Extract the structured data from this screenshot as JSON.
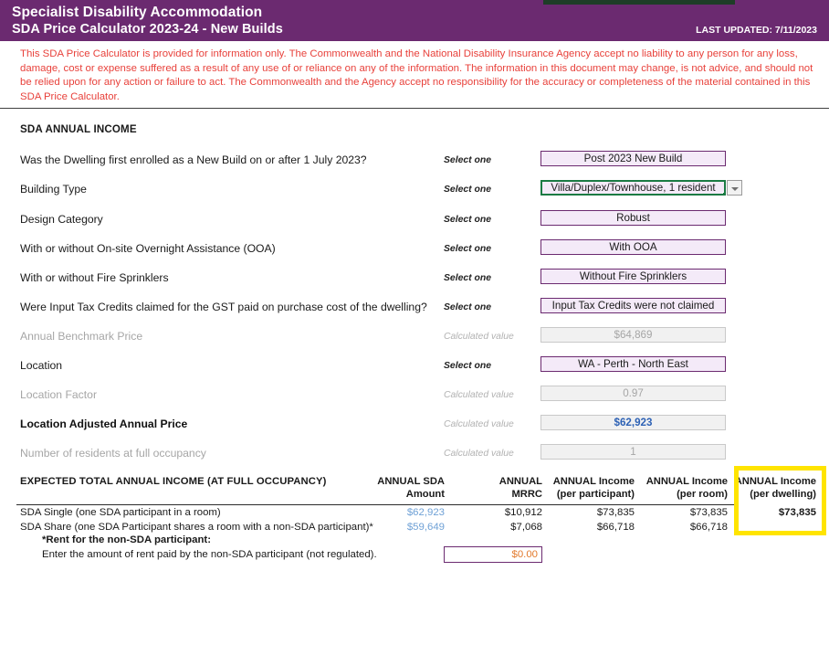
{
  "header": {
    "title": "Specialist Disability Accommodation",
    "subtitle": "SDA Price Calculator 2023-24 - New Builds",
    "last_updated": "LAST UPDATED: 7/11/2023",
    "bg_color": "#6B2A70"
  },
  "disclaimer": {
    "text": "This SDA Price Calculator is provided for information only.  The Commonwealth and the National Disability Insurance Agency accept no liability to any person for any loss, damage, cost or expense suffered as a result of any use of or reliance on any of the information.  The information in this document may change, is not advice, and should not be relied upon for any action or failure to act. The Commonwealth and the Agency accept no responsibility for the accuracy or completeness of the material contained in this SDA Price Calculator.",
    "color": "#E8413B"
  },
  "section": {
    "heading": "SDA ANNUAL INCOME"
  },
  "hints": {
    "select_one": "Select one",
    "calculated_value": "Calculated value"
  },
  "form": {
    "rows": [
      {
        "label": "Was the Dwelling first enrolled as a New Build on or after 1 July 2023?",
        "hint": "Select one",
        "value": "Post 2023 New Build",
        "kind": "select"
      },
      {
        "label": "Building Type",
        "hint": "Select one",
        "value": "Villa/Duplex/Townhouse, 1 resident",
        "kind": "select-active"
      },
      {
        "label": "Design Category",
        "hint": "Select one",
        "value": "Robust",
        "kind": "select"
      },
      {
        "label": "With or without On-site Overnight Assistance (OOA)",
        "hint": "Select one",
        "value": "With OOA",
        "kind": "select"
      },
      {
        "label": "With or without Fire Sprinklers",
        "hint": "Select one",
        "value": "Without Fire Sprinklers",
        "kind": "select"
      },
      {
        "label": "Were Input Tax Credits claimed for the GST paid on purchase cost of the dwelling?",
        "hint": "Select one",
        "value": "Input Tax Credits were not claimed",
        "kind": "select"
      },
      {
        "label": "Annual Benchmark Price",
        "hint": "Calculated value",
        "value": "$64,869",
        "kind": "calc"
      },
      {
        "label": "Location",
        "hint": "Select one",
        "value": "WA - Perth - North East",
        "kind": "select"
      },
      {
        "label": "Location Factor",
        "hint": "Calculated value",
        "value": "0.97",
        "kind": "calc"
      },
      {
        "label": "Location Adjusted Annual Price",
        "hint": "Calculated value",
        "value": "$62,923",
        "kind": "calc-strong"
      },
      {
        "label": "Number of residents at full occupancy",
        "hint": "Calculated value",
        "value": "1",
        "kind": "calc"
      }
    ]
  },
  "results": {
    "title": "EXPECTED TOTAL ANNUAL INCOME (AT FULL OCCUPANCY)",
    "columns": [
      {
        "line1": "ANNUAL SDA",
        "line2": "Amount"
      },
      {
        "line1": "ANNUAL",
        "line2": "MRRC"
      },
      {
        "line1": "ANNUAL Income",
        "line2": "(per participant)"
      },
      {
        "line1": "ANNUAL Income",
        "line2": "(per room)"
      },
      {
        "line1": "ANNUAL Income",
        "line2": "(per dwelling)"
      }
    ],
    "rows": [
      {
        "label": "SDA Single (one SDA participant in a room)",
        "sda_amount": "$62,923",
        "mrrc": "$10,912",
        "per_participant": "$73,835",
        "per_room": "$73,835",
        "per_dwelling": "$73,835"
      },
      {
        "label": "SDA Share (one SDA Participant shares a room with a non-SDA participant)*",
        "sda_amount": "$59,649",
        "mrrc": "$7,068",
        "per_participant": "$66,718",
        "per_room": "$66,718",
        "per_dwelling": ""
      }
    ],
    "note_bold": "*Rent for the non-SDA participant:",
    "note_plain": "Enter the amount of rent paid by the non-SDA participant (not regulated).",
    "rent_value": "$0.00",
    "highlight_color": "#FFE400"
  }
}
